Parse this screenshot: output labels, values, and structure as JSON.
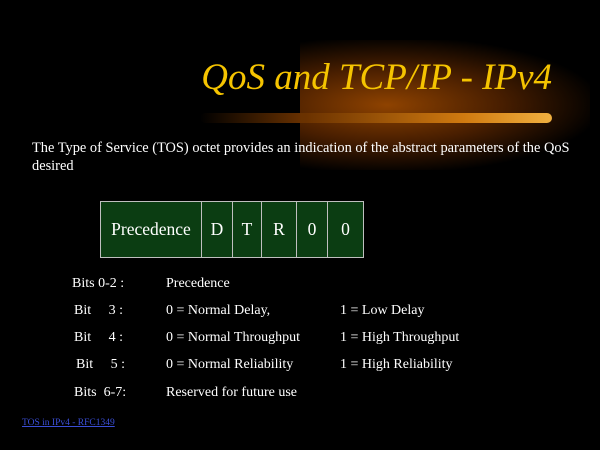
{
  "title": "QoS and TCP/IP -  IPv4",
  "intro": "The Type of Service (TOS)  octet provides an indication of the abstract parameters of the QoS desired",
  "tos_fields": [
    "Precedence",
    "D",
    "T",
    "R",
    "0",
    "0"
  ],
  "bits": [
    {
      "bits": "Bits 0-2 :",
      "meaning0": "Precedence",
      "meaning1": ""
    },
    {
      "bits": "Bit     3 :",
      "meaning0": "0 = Normal Delay,",
      "meaning1": "1 = Low Delay"
    },
    {
      "bits": "Bit     4 :",
      "meaning0": "0 = Normal Throughput",
      "meaning1": "1 = High Throughput"
    },
    {
      "bits": "Bit     5 :",
      "meaning0": "0 = Normal Reliability",
      "meaning1": "1 = High Reliability"
    },
    {
      "bits": "Bits  6-7:",
      "meaning0": "Reserved for future use",
      "meaning1": ""
    }
  ],
  "footer_link": "TOS in IPv4 - RFC1349"
}
